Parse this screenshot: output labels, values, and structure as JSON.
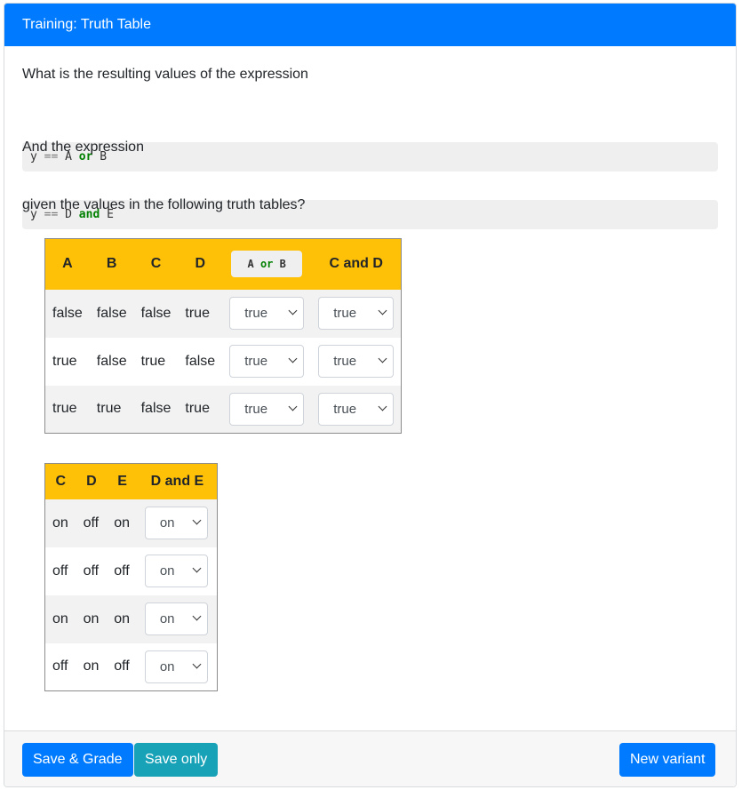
{
  "header": {
    "title": "Training: Truth Table"
  },
  "question": {
    "line1": "What is the resulting values of the expression",
    "expr1": {
      "lhs": "y",
      "op": "==",
      "a": "A",
      "kw": "or",
      "b": "B"
    },
    "line2": "And the expression",
    "expr2": {
      "lhs": "y",
      "op": "==",
      "a": "D",
      "kw": "and",
      "b": "E"
    },
    "line3": "given the values in the following truth tables?"
  },
  "table1": {
    "headers": [
      "A",
      "B",
      "C",
      "D"
    ],
    "expr_header": {
      "a": "A",
      "kw": "or",
      "b": "B"
    },
    "last_header": "C and D",
    "rows": [
      {
        "cells": [
          "false",
          "false",
          "false",
          "true"
        ],
        "sel1": "true",
        "sel2": "true"
      },
      {
        "cells": [
          "true",
          "false",
          "true",
          "false"
        ],
        "sel1": "true",
        "sel2": "true"
      },
      {
        "cells": [
          "true",
          "true",
          "false",
          "true"
        ],
        "sel1": "true",
        "sel2": "true"
      }
    ]
  },
  "table2": {
    "headers": [
      "C",
      "D",
      "E"
    ],
    "last_header": "D and E",
    "rows": [
      {
        "cells": [
          "on",
          "off",
          "on"
        ],
        "sel": "on"
      },
      {
        "cells": [
          "off",
          "off",
          "off"
        ],
        "sel": "on"
      },
      {
        "cells": [
          "on",
          "on",
          "on"
        ],
        "sel": "on"
      },
      {
        "cells": [
          "off",
          "on",
          "off"
        ],
        "sel": "on"
      }
    ]
  },
  "footer": {
    "save_grade": "Save & Grade",
    "save_only": "Save only",
    "new_variant": "New variant"
  },
  "colors": {
    "primary": "#007bff",
    "info": "#17a2b8",
    "table_header": "#ffc107",
    "keyword": "#008000"
  }
}
